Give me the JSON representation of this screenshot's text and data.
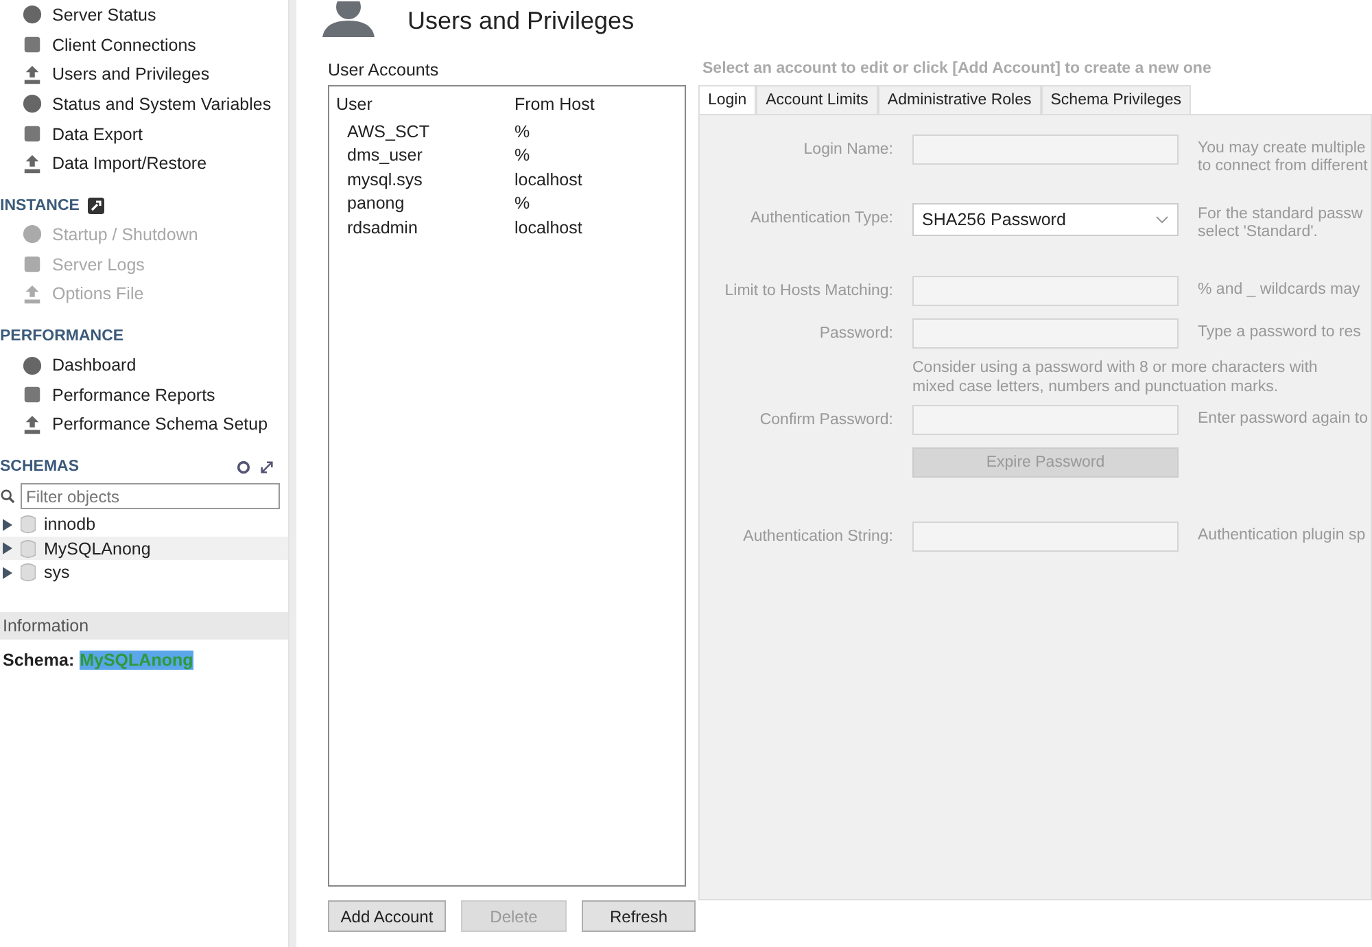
{
  "sidebar": {
    "sections": [
      {
        "items": [
          {
            "label": "Server Status",
            "disabled": false
          },
          {
            "label": "Client Connections",
            "disabled": false
          },
          {
            "label": "Users and Privileges",
            "disabled": false
          },
          {
            "label": "Status and System Variables",
            "disabled": false
          },
          {
            "label": "Data Export",
            "disabled": false
          },
          {
            "label": "Data Import/Restore",
            "disabled": false
          }
        ]
      },
      {
        "heading": "INSTANCE",
        "items": [
          {
            "label": "Startup / Shutdown",
            "disabled": true
          },
          {
            "label": "Server Logs",
            "disabled": true
          },
          {
            "label": "Options File",
            "disabled": true
          }
        ]
      },
      {
        "heading": "PERFORMANCE",
        "items": [
          {
            "label": "Dashboard",
            "disabled": false
          },
          {
            "label": "Performance Reports",
            "disabled": false
          },
          {
            "label": "Performance Schema Setup",
            "disabled": false
          }
        ]
      }
    ],
    "schemas": {
      "heading": "SCHEMAS",
      "filter_placeholder": "Filter objects",
      "items": [
        {
          "name": "innodb",
          "selected": false
        },
        {
          "name": "MySQLAnong",
          "selected": true
        },
        {
          "name": "sys",
          "selected": false
        }
      ]
    },
    "information": {
      "heading": "Information",
      "label": "Schema:",
      "value": "MySQLAnong"
    }
  },
  "main": {
    "title": "Users and Privileges",
    "accounts": {
      "heading": "User Accounts",
      "columns": [
        "User",
        "From Host"
      ],
      "rows": [
        {
          "user": "AWS_SCT",
          "host": "%"
        },
        {
          "user": "dms_user",
          "host": "%"
        },
        {
          "user": "mysql.sys",
          "host": "localhost"
        },
        {
          "user": "panong",
          "host": "%"
        },
        {
          "user": "rdsadmin",
          "host": "localhost"
        }
      ]
    },
    "buttons": [
      {
        "label": "Add Account",
        "disabled": false
      },
      {
        "label": "Delete",
        "disabled": true
      },
      {
        "label": "Refresh",
        "disabled": false
      }
    ],
    "instruction": "Select an account to edit or click [Add Account] to create a new one",
    "tabs": [
      {
        "label": "Login",
        "selected": true
      },
      {
        "label": "Account Limits",
        "selected": false
      },
      {
        "label": "Administrative Roles",
        "selected": false
      },
      {
        "label": "Schema Privileges",
        "selected": false
      }
    ],
    "form": {
      "disabled": true,
      "rows": [
        {
          "kind": "field",
          "label": "Login Name:",
          "hint": [
            "You may create multiple",
            "to connect from different"
          ]
        },
        {
          "kind": "select",
          "label": "Authentication Type:",
          "value": "SHA256 Password",
          "hint": [
            "For the standard passw",
            "select 'Standard'."
          ]
        },
        {
          "kind": "field",
          "label": "Limit to Hosts Matching:",
          "hint": [
            "% and _ wildcards may"
          ]
        },
        {
          "kind": "field",
          "label": "Password:",
          "hint": [
            "Type a password to res"
          ]
        },
        {
          "kind": "note",
          "hint": [
            "Consider using a password with 8 or more characters with",
            "mixed case letters, numbers and punctuation marks."
          ]
        },
        {
          "kind": "field",
          "label": "Confirm Password:",
          "hint": [
            "Enter password again to"
          ]
        },
        {
          "kind": "button",
          "label": "Expire Password"
        },
        {
          "kind": "field",
          "label": "Authentication String:",
          "hint": [
            "Authentication plugin sp"
          ]
        }
      ]
    }
  }
}
